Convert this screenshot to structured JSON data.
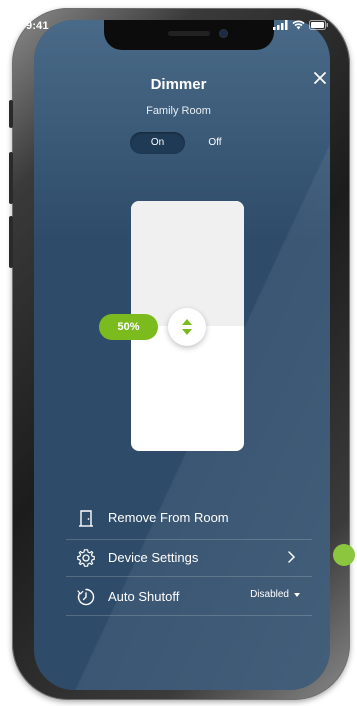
{
  "status_bar": {
    "time": "9:41"
  },
  "header": {
    "title": "Dimmer",
    "subtitle": "Family Room",
    "close_icon": "close-icon"
  },
  "power_toggle": {
    "on_label": "On",
    "off_label": "Off",
    "selected": "On"
  },
  "dimmer": {
    "level_percent": 50,
    "level_label": "50%",
    "handle_icon": "up-down-arrows-icon"
  },
  "menu": {
    "remove": {
      "label": "Remove From Room",
      "icon": "door-icon"
    },
    "settings": {
      "label": "Device Settings",
      "icon": "gear-icon"
    },
    "auto_shutoff": {
      "label": "Auto Shutoff",
      "icon": "timer-icon",
      "value": "Disabled"
    }
  },
  "colors": {
    "screen_bg": "#2e4c6a",
    "accent_green": "#7cbb1e",
    "toggle_selected": "#1f3a55"
  }
}
